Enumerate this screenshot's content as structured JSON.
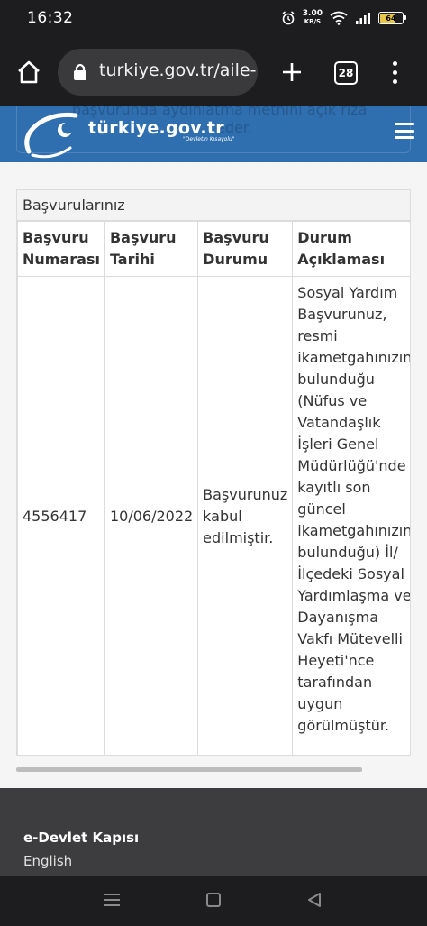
{
  "status": {
    "time": "16:32",
    "net_speed_value": "3.00",
    "net_speed_unit": "KB/S",
    "battery": "64"
  },
  "browser": {
    "url": "turkiye.gov.tr/aile-",
    "tab_count": "28"
  },
  "site": {
    "logo_text": "türkiye.gov.tr",
    "logo_tagline": "\"Devletin Kısayolu\"",
    "behind_text_1": "başvurunda aydınlatma metnini açık rıza",
    "behind_text_2": "eder."
  },
  "panel": {
    "heading": "Başvurularınız",
    "columns": [
      "Başvuru Numarası",
      "Başvuru Tarihi",
      "Başvuru Durumu",
      "Durum Açıklaması"
    ],
    "rows": [
      {
        "number": "4556417",
        "date": "10/06/2022",
        "status": "Başvurunuz kabul edilmiştir.",
        "description": "Sosyal Yardım Başvurunuz, resmi ikametgahınızın bulunduğu (Nüfus ve Vatandaşlık İşleri Genel Müdürlüğü'nde kayıtlı son güncel ikametgahınızın bulunduğu) İl/İlçedeki Sosyal Yardımlaşma ve Dayanışma Vakfı Mütevelli Heyeti'nce tarafından uygun görülmüştür."
      }
    ]
  },
  "footer": {
    "title": "e-Devlet Kapısı",
    "link": "English"
  },
  "colors": {
    "header_blue": "#2f6fb0",
    "dark_bar": "#1d1d1f",
    "footer": "#3d3d3f"
  }
}
